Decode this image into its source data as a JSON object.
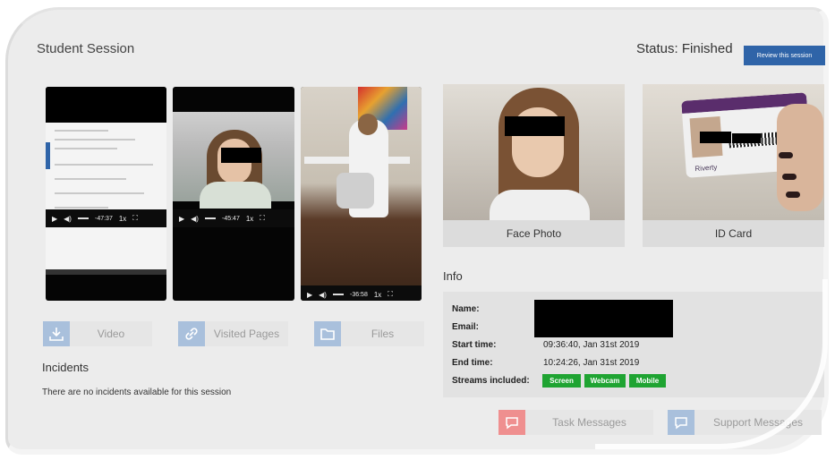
{
  "header": {
    "title": "Student Session",
    "status": "Status: Finished",
    "review_button": "Review this session"
  },
  "players": [
    {
      "kind": "Screen",
      "time": "-47:37",
      "speed": "1x"
    },
    {
      "kind": "Webcam",
      "time": "-45:47",
      "speed": "1x"
    },
    {
      "kind": "Mobile",
      "time": "-36:58",
      "speed": "1x"
    }
  ],
  "media_buttons": {
    "video": "Video",
    "visited_pages": "Visited Pages",
    "files": "Files"
  },
  "incidents": {
    "title": "Incidents",
    "message": "There are no incidents available for this session"
  },
  "photos": {
    "face_label": "Face Photo",
    "id_label": "ID Card",
    "id_logo": "Riverty"
  },
  "info": {
    "title": "Info",
    "name_label": "Name:",
    "email_label": "Email:",
    "start_label": "Start time:",
    "start_value": "09:36:40, Jan 31st 2019",
    "end_label": "End time:",
    "end_value": "10:24:26, Jan 31st 2019",
    "streams_label": "Streams included:",
    "streams": [
      "Screen",
      "Webcam",
      "Mobile"
    ]
  },
  "message_buttons": {
    "task": "Task Messages",
    "support": "Support Messages"
  },
  "colors": {
    "primary": "#2f64a8",
    "stream_chip": "#1fa432",
    "background": "#ececec"
  }
}
